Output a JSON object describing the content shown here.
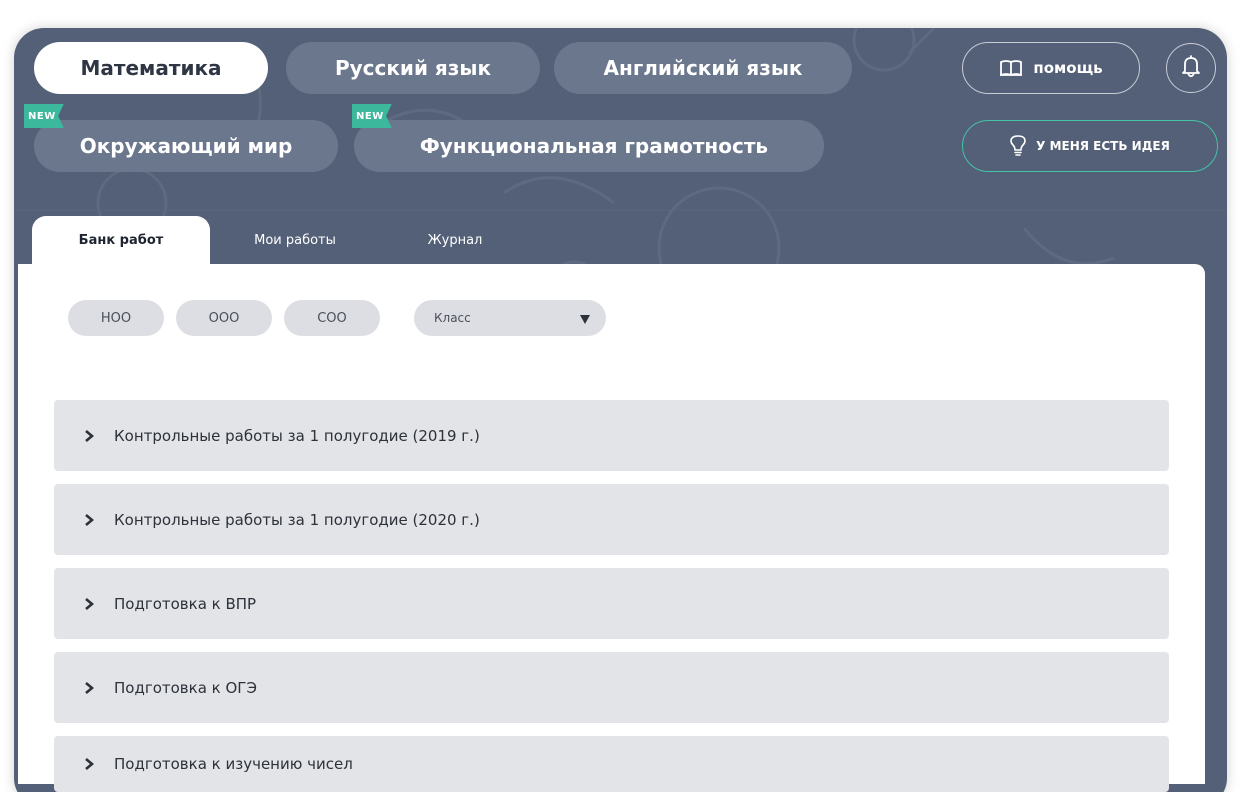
{
  "subjects": {
    "row1": [
      {
        "label": "Математика",
        "active": true
      },
      {
        "label": "Русский язык",
        "active": false
      },
      {
        "label": "Английский язык",
        "active": false
      }
    ],
    "row2": [
      {
        "label": "Окружающий мир",
        "badge": "NEW"
      },
      {
        "label": "Функциональная грамотность",
        "badge": "NEW"
      }
    ]
  },
  "header": {
    "help_label": "помощь",
    "help_icon": "book-icon",
    "notify_icon": "bell-icon",
    "idea_label": "у меня есть идея",
    "idea_icon": "lightbulb-icon"
  },
  "tabs": [
    {
      "label": "Банк работ",
      "active": true
    },
    {
      "label": "Мои работы",
      "active": false
    },
    {
      "label": "Журнал",
      "active": false
    }
  ],
  "filters": {
    "levels": [
      "НОО",
      "ООО",
      "СОО"
    ],
    "class_select": {
      "value": "Класс",
      "icon": "triangle-down-icon"
    }
  },
  "sections": [
    {
      "label": "Контрольные работы за 1 полугодие (2019 г.)"
    },
    {
      "label": "Контрольные работы за 1 полугодие (2020 г.)"
    },
    {
      "label": "Подготовка к ВПР"
    },
    {
      "label": "Подготовка к ОГЭ"
    },
    {
      "label": "Подготовка к изучению чисел"
    }
  ],
  "colors": {
    "background": "#536077",
    "pill_inactive": "#6b778c",
    "badge": "#3cb99c",
    "idea_border": "#45c2a7",
    "accordion": "#e3e4e8",
    "chip": "#dddee3"
  }
}
